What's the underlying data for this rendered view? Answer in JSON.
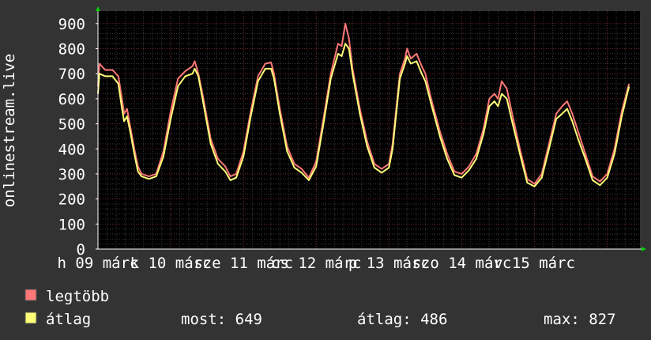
{
  "colors": {
    "background": "#333333",
    "plot_background": "#000000",
    "grid_minor": "#3a3a3a",
    "grid_major": "#6e2b2b",
    "axis": "#ffffff",
    "arrow": "#00cc00",
    "text": "#ffffff",
    "max_series": "#ff7777",
    "avg_series": "#ffff77"
  },
  "chart_data": {
    "type": "line",
    "ylabel": "onlinestream.live",
    "ylim": [
      0,
      950
    ],
    "yticks": [
      "0",
      "100",
      "200",
      "300",
      "400",
      "500",
      "600",
      "700",
      "800",
      "900"
    ],
    "x_range": [
      0,
      7.45
    ],
    "x_labels": [
      {
        "text": "h 09 márc",
        "x": 0.0
      },
      {
        "text": "k 10 márc",
        "x": 1.0
      },
      {
        "text": "sze 11 márc",
        "x": 2.0
      },
      {
        "text": "cs 12 márc",
        "x": 3.0
      },
      {
        "text": "p 13 márc",
        "x": 4.0
      },
      {
        "text": "szo 14 márc",
        "x": 5.0
      },
      {
        "text": "v 15 márc",
        "x": 6.0
      }
    ],
    "grid": true,
    "series": [
      {
        "name": "legtöbb",
        "color": "#ff7777",
        "points": [
          [
            0.0,
            650
          ],
          [
            0.02,
            740
          ],
          [
            0.1,
            715
          ],
          [
            0.2,
            715
          ],
          [
            0.28,
            690
          ],
          [
            0.33,
            600
          ],
          [
            0.36,
            540
          ],
          [
            0.4,
            560
          ],
          [
            0.45,
            480
          ],
          [
            0.5,
            400
          ],
          [
            0.55,
            330
          ],
          [
            0.6,
            300
          ],
          [
            0.7,
            290
          ],
          [
            0.8,
            300
          ],
          [
            0.9,
            390
          ],
          [
            1.0,
            550
          ],
          [
            1.1,
            680
          ],
          [
            1.2,
            710
          ],
          [
            1.3,
            730
          ],
          [
            1.33,
            750
          ],
          [
            1.38,
            700
          ],
          [
            1.45,
            600
          ],
          [
            1.55,
            440
          ],
          [
            1.65,
            360
          ],
          [
            1.75,
            330
          ],
          [
            1.82,
            290
          ],
          [
            1.9,
            300
          ],
          [
            2.0,
            390
          ],
          [
            2.1,
            550
          ],
          [
            2.2,
            690
          ],
          [
            2.3,
            740
          ],
          [
            2.38,
            745
          ],
          [
            2.42,
            700
          ],
          [
            2.5,
            560
          ],
          [
            2.6,
            410
          ],
          [
            2.7,
            340
          ],
          [
            2.8,
            320
          ],
          [
            2.9,
            285
          ],
          [
            3.0,
            350
          ],
          [
            3.1,
            520
          ],
          [
            3.2,
            700
          ],
          [
            3.3,
            820
          ],
          [
            3.35,
            810
          ],
          [
            3.4,
            900
          ],
          [
            3.45,
            840
          ],
          [
            3.5,
            720
          ],
          [
            3.6,
            560
          ],
          [
            3.7,
            430
          ],
          [
            3.8,
            340
          ],
          [
            3.9,
            320
          ],
          [
            4.0,
            340
          ],
          [
            4.05,
            420
          ],
          [
            4.1,
            560
          ],
          [
            4.15,
            700
          ],
          [
            4.22,
            760
          ],
          [
            4.25,
            800
          ],
          [
            4.3,
            760
          ],
          [
            4.38,
            780
          ],
          [
            4.45,
            730
          ],
          [
            4.5,
            700
          ],
          [
            4.58,
            600
          ],
          [
            4.7,
            470
          ],
          [
            4.8,
            380
          ],
          [
            4.9,
            310
          ],
          [
            5.0,
            300
          ],
          [
            5.1,
            330
          ],
          [
            5.2,
            380
          ],
          [
            5.3,
            480
          ],
          [
            5.38,
            600
          ],
          [
            5.45,
            620
          ],
          [
            5.5,
            600
          ],
          [
            5.55,
            670
          ],
          [
            5.62,
            640
          ],
          [
            5.7,
            530
          ],
          [
            5.8,
            400
          ],
          [
            5.9,
            280
          ],
          [
            6.0,
            260
          ],
          [
            6.1,
            300
          ],
          [
            6.2,
            420
          ],
          [
            6.3,
            540
          ],
          [
            6.38,
            570
          ],
          [
            6.45,
            590
          ],
          [
            6.52,
            540
          ],
          [
            6.6,
            470
          ],
          [
            6.7,
            380
          ],
          [
            6.8,
            290
          ],
          [
            6.9,
            270
          ],
          [
            7.0,
            300
          ],
          [
            7.1,
            400
          ],
          [
            7.2,
            550
          ],
          [
            7.3,
            660
          ]
        ]
      },
      {
        "name": "átlag",
        "color": "#ffff77",
        "points": [
          [
            0.0,
            620
          ],
          [
            0.02,
            700
          ],
          [
            0.1,
            690
          ],
          [
            0.2,
            690
          ],
          [
            0.28,
            660
          ],
          [
            0.33,
            560
          ],
          [
            0.36,
            510
          ],
          [
            0.4,
            530
          ],
          [
            0.45,
            460
          ],
          [
            0.5,
            380
          ],
          [
            0.55,
            310
          ],
          [
            0.6,
            290
          ],
          [
            0.7,
            280
          ],
          [
            0.8,
            290
          ],
          [
            0.9,
            370
          ],
          [
            1.0,
            520
          ],
          [
            1.1,
            650
          ],
          [
            1.2,
            690
          ],
          [
            1.3,
            700
          ],
          [
            1.33,
            720
          ],
          [
            1.38,
            690
          ],
          [
            1.45,
            580
          ],
          [
            1.55,
            420
          ],
          [
            1.65,
            340
          ],
          [
            1.75,
            310
          ],
          [
            1.82,
            275
          ],
          [
            1.9,
            285
          ],
          [
            2.0,
            370
          ],
          [
            2.1,
            530
          ],
          [
            2.2,
            670
          ],
          [
            2.3,
            720
          ],
          [
            2.38,
            720
          ],
          [
            2.42,
            680
          ],
          [
            2.5,
            540
          ],
          [
            2.6,
            390
          ],
          [
            2.7,
            325
          ],
          [
            2.8,
            305
          ],
          [
            2.9,
            275
          ],
          [
            3.0,
            330
          ],
          [
            3.1,
            500
          ],
          [
            3.2,
            680
          ],
          [
            3.3,
            780
          ],
          [
            3.35,
            770
          ],
          [
            3.4,
            820
          ],
          [
            3.45,
            800
          ],
          [
            3.5,
            700
          ],
          [
            3.6,
            540
          ],
          [
            3.7,
            410
          ],
          [
            3.8,
            325
          ],
          [
            3.9,
            305
          ],
          [
            4.0,
            325
          ],
          [
            4.05,
            400
          ],
          [
            4.1,
            540
          ],
          [
            4.15,
            680
          ],
          [
            4.22,
            740
          ],
          [
            4.25,
            770
          ],
          [
            4.3,
            740
          ],
          [
            4.38,
            750
          ],
          [
            4.45,
            700
          ],
          [
            4.5,
            670
          ],
          [
            4.58,
            580
          ],
          [
            4.7,
            450
          ],
          [
            4.8,
            360
          ],
          [
            4.9,
            295
          ],
          [
            5.0,
            285
          ],
          [
            5.1,
            315
          ],
          [
            5.2,
            360
          ],
          [
            5.3,
            460
          ],
          [
            5.38,
            570
          ],
          [
            5.45,
            590
          ],
          [
            5.5,
            570
          ],
          [
            5.55,
            620
          ],
          [
            5.62,
            600
          ],
          [
            5.7,
            500
          ],
          [
            5.8,
            380
          ],
          [
            5.9,
            265
          ],
          [
            6.0,
            250
          ],
          [
            6.1,
            285
          ],
          [
            6.2,
            400
          ],
          [
            6.3,
            520
          ],
          [
            6.38,
            540
          ],
          [
            6.45,
            560
          ],
          [
            6.52,
            510
          ],
          [
            6.6,
            440
          ],
          [
            6.7,
            360
          ],
          [
            6.8,
            275
          ],
          [
            6.9,
            255
          ],
          [
            7.0,
            285
          ],
          [
            7.1,
            380
          ],
          [
            7.2,
            530
          ],
          [
            7.3,
            649
          ]
        ]
      }
    ]
  },
  "legend": {
    "items": [
      {
        "label": "legtöbb",
        "color": "#ff7777"
      },
      {
        "label": "átlag",
        "color": "#ffff77"
      }
    ],
    "stats": {
      "most": "most: 649",
      "atlag": "átlag: 486",
      "max": "max: 827"
    }
  }
}
